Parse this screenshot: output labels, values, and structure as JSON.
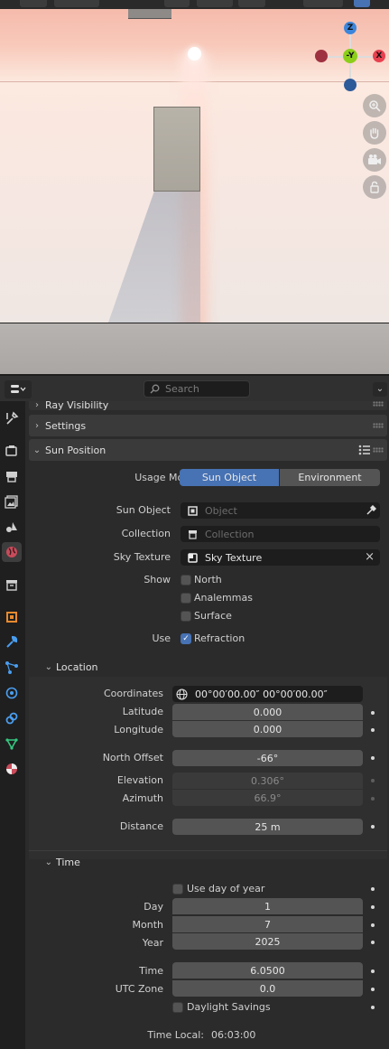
{
  "header": {
    "search_placeholder": "Search"
  },
  "panels": {
    "ray_visibility": "Ray Visibility",
    "settings": "Settings",
    "sun_position": "Sun Position"
  },
  "sun_position": {
    "usage_mode_label": "Usage Mode",
    "usage_mode_options": [
      "Sun Object",
      "Environment"
    ],
    "usage_mode_selected": "Sun Object",
    "sun_object_label": "Sun Object",
    "sun_object_placeholder": "Object",
    "collection_label": "Collection",
    "collection_placeholder": "Collection",
    "sky_texture_label": "Sky Texture",
    "sky_texture_value": "Sky Texture",
    "show_label": "Show",
    "show_options": [
      {
        "label": "North",
        "checked": false
      },
      {
        "label": "Analemmas",
        "checked": false
      },
      {
        "label": "Surface",
        "checked": false
      }
    ],
    "use_label": "Use",
    "use_refraction": {
      "label": "Refraction",
      "checked": true
    }
  },
  "location": {
    "title": "Location",
    "coordinates_label": "Coordinates",
    "coordinates_value": "00°00′00.00″ 00°00′00.00″",
    "latitude_label": "Latitude",
    "latitude_value": "0.000",
    "longitude_label": "Longitude",
    "longitude_value": "0.000",
    "north_offset_label": "North Offset",
    "north_offset_value": "-66°",
    "elevation_label": "Elevation",
    "elevation_value": "0.306°",
    "azimuth_label": "Azimuth",
    "azimuth_value": "66.9°",
    "distance_label": "Distance",
    "distance_value": "25 m"
  },
  "time": {
    "title": "Time",
    "use_day_of_year": {
      "label": "Use day of year",
      "checked": false
    },
    "day_label": "Day",
    "day_value": "1",
    "month_label": "Month",
    "month_value": "7",
    "year_label": "Year",
    "year_value": "2025",
    "time_label": "Time",
    "time_value": "6.0500",
    "utc_zone_label": "UTC Zone",
    "utc_zone_value": "0.0",
    "daylight_savings": {
      "label": "Daylight Savings",
      "checked": false
    },
    "time_local_label": "Time Local:",
    "time_local_value": "06:03:00"
  },
  "gizmo": {
    "z": "Z",
    "y": "-Y",
    "x": "X"
  },
  "colors": {
    "accent": "#4772b3",
    "axis_x": "#e8404f",
    "axis_y": "#8bcf1a",
    "axis_z": "#3b86dc"
  }
}
